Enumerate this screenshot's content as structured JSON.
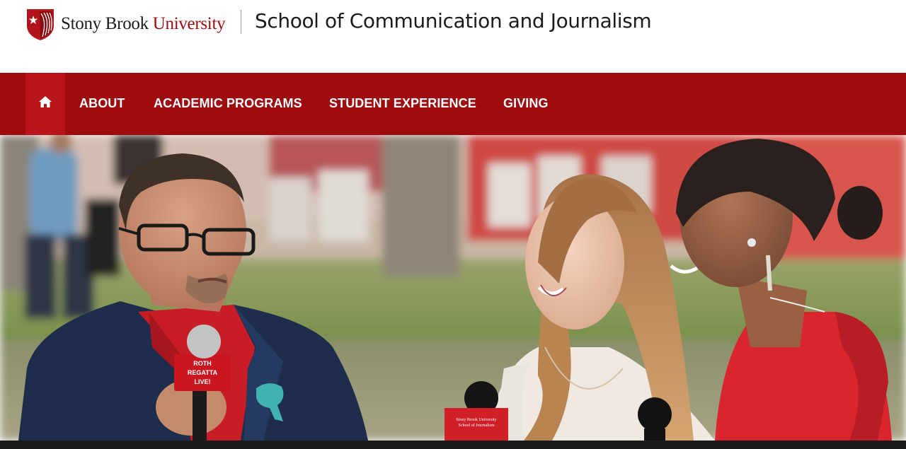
{
  "header": {
    "university_name_part1": "Stony Brook ",
    "university_name_part2": "University",
    "school_title": "School of Communication and Journalism",
    "logo_icon": "sbu-shield-icon"
  },
  "nav": {
    "home_icon": "home-icon",
    "items": [
      {
        "label": "ABOUT"
      },
      {
        "label": "ACADEMIC PROGRAMS"
      },
      {
        "label": "STUDENT EXPERIENCE"
      },
      {
        "label": "GIVING"
      }
    ]
  },
  "hero": {
    "mic_flag_left": [
      "ROTH",
      "REGATTA",
      "LIVE!"
    ],
    "mic_flag_center": [
      "Stony Brook University",
      "School of Journalism"
    ]
  },
  "colors": {
    "brand_red": "#9f0c10",
    "nav_home_active": "#b8141a",
    "wordmark_red": "#9e0b0f"
  }
}
